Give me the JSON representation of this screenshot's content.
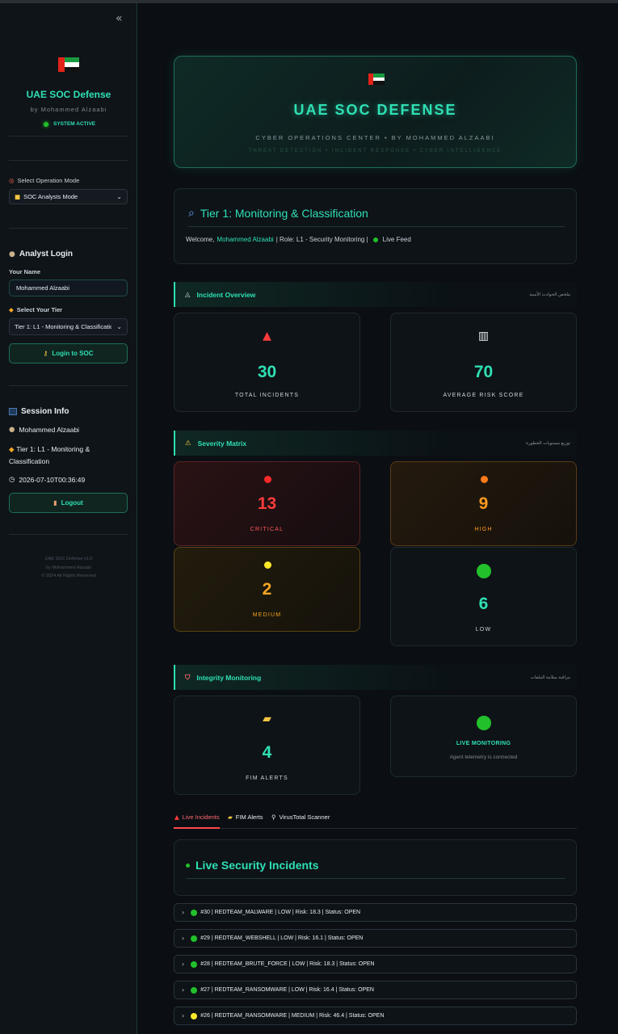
{
  "sidebar": {
    "collapse_icon": "«",
    "brand_title": "UAE SOC Defense",
    "brand_subtitle": "by Mohammed Alzaabi",
    "status": "SYSTEM ACTIVE",
    "mode_label": "Select Operation Mode",
    "mode_value": "SOC Analysts Mode",
    "login_heading": "Analyst Login",
    "name_label": "Your Name",
    "name_value": "Mohammed Alzaabi",
    "tier_label": "Select Your Tier",
    "tier_value": "Tier 1: L1 - Monitoring & Classificatic",
    "login_button": "Login to SOC",
    "session_heading": "Session Info",
    "session_name": "Mohammed Alzaabi",
    "session_tier": "Tier 1: L1 - Monitoring & Classification",
    "session_time": "2026-07-10T00:36:49",
    "logout_button": "Logout",
    "footer": [
      "UAE SOC Defense v1.0",
      "by Mohammed Alzaabi",
      "© 2024 All Rights Reserved"
    ]
  },
  "hero": {
    "title": "UAE SOC DEFENSE",
    "subtitle": "CYBER OPERATIONS CENTER • BY MOHAMMED ALZAABI",
    "tagline": "THREAT DETECTION • INCIDENT RESPONSE • CYBER INTELLIGENCE"
  },
  "tier_card": {
    "title": "Tier 1: Monitoring & Classification",
    "welcome_prefix": "Welcome,",
    "user": "Mohammed Alzaabi",
    "role": "| Role: L1 - Security Monitoring |",
    "feed": "Live Feed"
  },
  "incident_overview": {
    "title": "Incident Overview",
    "arabic": "ملخص الحوادث الأمنية",
    "total_value": "30",
    "total_label": "TOTAL INCIDENTS",
    "risk_value": "70",
    "risk_label": "AVERAGE RISK SCORE"
  },
  "severity": {
    "title": "Severity Matrix",
    "arabic": "توزيع مستويات الخطورة",
    "critical_value": "13",
    "critical_label": "CRITICAL",
    "high_value": "9",
    "high_label": "HIGH",
    "medium_value": "2",
    "medium_label": "MEDIUM",
    "low_value": "6",
    "low_label": "LOW"
  },
  "integrity": {
    "title": "Integrity Monitoring",
    "arabic": "مراقبة سلامة الملفات",
    "fim_value": "4",
    "fim_label": "FIM ALERTS",
    "live_title": "LIVE MONITORING",
    "live_sub": "Agent telemetry is connected"
  },
  "tabs": [
    "Live Incidents",
    "FIM Alerts",
    "VirusTotal Scanner"
  ],
  "live_heading": "Live Security Incidents",
  "incidents": [
    {
      "text": "#30 | REDTEAM_MALWARE | LOW | Risk: 18.3 | Status: OPEN",
      "color": "#22c02a"
    },
    {
      "text": "#29 | REDTEAM_WEBSHELL | LOW | Risk: 16.1 | Status: OPEN",
      "color": "#22c02a"
    },
    {
      "text": "#28 | REDTEAM_BRUTE_FORCE | LOW | Risk: 18.3 | Status: OPEN",
      "color": "#22c02a"
    },
    {
      "text": "#27 | REDTEAM_RANSOMWARE | LOW | Risk: 16.4 | Status: OPEN",
      "color": "#22c02a"
    },
    {
      "text": "#26 | REDTEAM_RANSOMWARE | MEDIUM | Risk: 46.4 | Status: OPEN",
      "color": "#f5e62a"
    }
  ],
  "colors": {
    "accent": "#2fe0b4",
    "critical": "#ff3b3b",
    "high": "#ff9a1f",
    "medium": "#f5a623",
    "low_dot": "#22c02a"
  }
}
